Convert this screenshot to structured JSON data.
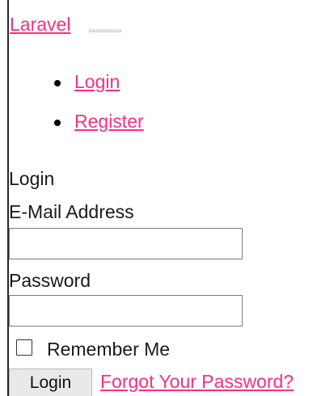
{
  "navbar": {
    "brand": "Laravel",
    "items": [
      {
        "label": "Login"
      },
      {
        "label": "Register"
      }
    ]
  },
  "card": {
    "title": "Login"
  },
  "form": {
    "email_label": "E-Mail Address",
    "email_value": "",
    "password_label": "Password",
    "password_value": "",
    "remember_label": "Remember Me",
    "remember_checked": false,
    "submit_label": "Login",
    "forgot_label": "Forgot Your Password?"
  },
  "colors": {
    "link": "#ff2d7a",
    "text": "#1a1a1a",
    "button_bg": "#e9e9e9"
  }
}
